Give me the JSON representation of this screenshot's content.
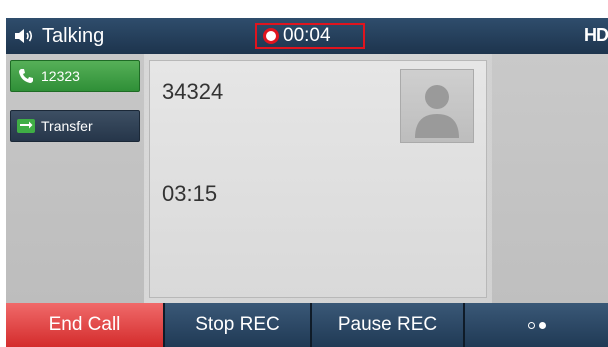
{
  "statusbar": {
    "status_text": "Talking",
    "recording_timer": "00:04",
    "hd_label": "HD",
    "speaker_icon": "speaker-icon",
    "record_icon": "record-dot-icon"
  },
  "line_keys": [
    {
      "label": "12323",
      "icon": "phone-icon",
      "state": "active"
    },
    {
      "label": "Transfer",
      "icon": "transfer-icon",
      "state": "normal"
    }
  ],
  "call": {
    "number": "34324",
    "duration": "03:15",
    "avatar_icon": "contact-avatar-icon"
  },
  "softkeys": [
    {
      "label": "End Call"
    },
    {
      "label": "Stop REC"
    },
    {
      "label": "Pause REC"
    },
    {
      "label": "",
      "icon": "more-dots-icon"
    }
  ],
  "colors": {
    "status_bar": "#1d344d",
    "record_red": "#e0141e",
    "line_active": "#2f8f37",
    "end_call": "#d42c2c",
    "softkey": "#203a55"
  }
}
